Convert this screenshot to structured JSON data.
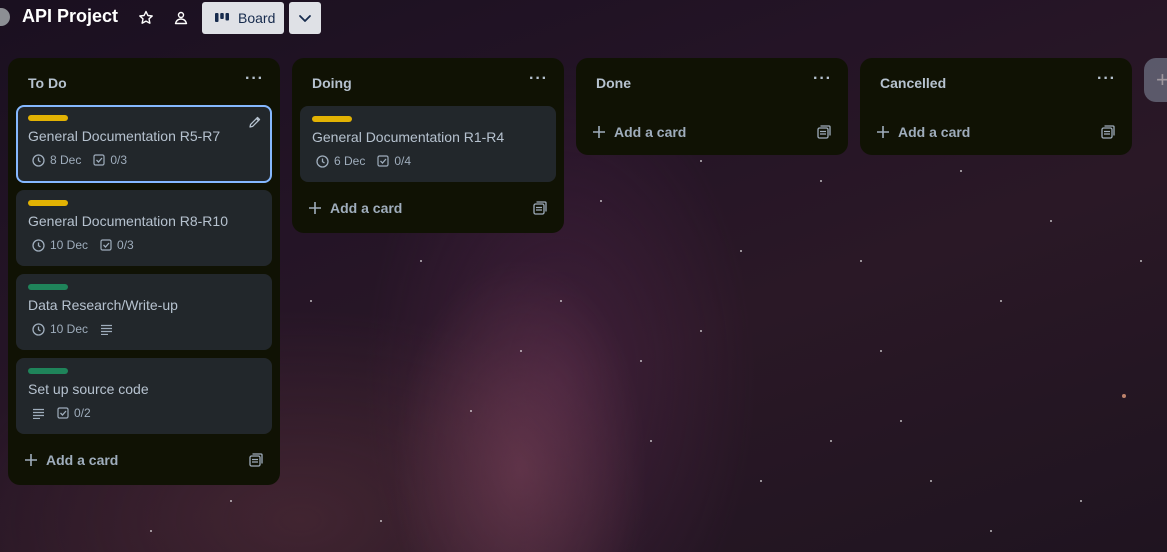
{
  "header": {
    "title": "API Project",
    "view_label": "Board"
  },
  "icons": {
    "star": "star-icon",
    "team": "team-icon",
    "board_view": "board-view-icon",
    "dropdown": "chevron-down-icon"
  },
  "lists": [
    {
      "title": "To Do",
      "menu": "···",
      "add_card_label": "Add a card",
      "cards": [
        {
          "label_color": "#e2b203",
          "title": "General Documentation R5-R7",
          "due": "8 Dec",
          "checklist": "0/3",
          "selected": true
        },
        {
          "label_color": "#e2b203",
          "title": "General Documentation R8-R10",
          "due": "10 Dec",
          "checklist": "0/3"
        },
        {
          "label_color": "#1f845a",
          "title": "Data Research/Write-up",
          "due": "10 Dec",
          "has_description": true
        },
        {
          "label_color": "#1f845a",
          "title": "Set up source code",
          "checklist": "0/2",
          "has_description": true
        }
      ]
    },
    {
      "title": "Doing",
      "menu": "···",
      "add_card_label": "Add a card",
      "cards": [
        {
          "label_color": "#e2b203",
          "title": "General Documentation R1-R4",
          "due": "6 Dec",
          "checklist": "0/4"
        }
      ]
    },
    {
      "title": "Done",
      "menu": "···",
      "add_card_label": "Add a card",
      "cards": []
    },
    {
      "title": "Cancelled",
      "menu": "···",
      "add_card_label": "Add a card",
      "cards": []
    }
  ],
  "add_list": {
    "label": "+"
  },
  "colors": {
    "list_bg": "#101204",
    "card_bg": "#22272b",
    "selected_border": "#85b8ff",
    "label_yellow": "#e2b203",
    "label_green": "#1f845a"
  }
}
